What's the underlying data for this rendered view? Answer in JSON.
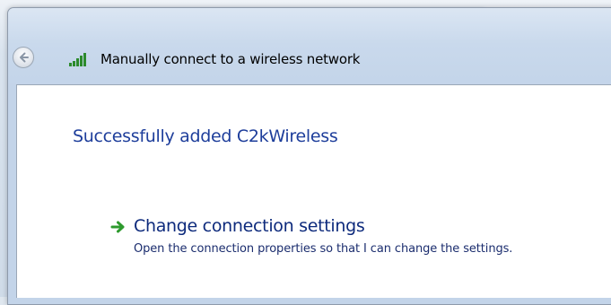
{
  "header": {
    "title": "Manually connect to a wireless network",
    "back_icon": "back-arrow-icon",
    "network_icon": "wireless-signal-icon"
  },
  "main": {
    "success_message": "Successfully added C2kWireless",
    "command_link": {
      "icon": "green-arrow-icon",
      "title": "Change connection settings",
      "description": "Open the connection properties so that I can change the settings."
    }
  },
  "colors": {
    "heading_blue": "#1e3e9b",
    "link_blue": "#0d2a7c",
    "arrow_green": "#2e9a2e"
  }
}
